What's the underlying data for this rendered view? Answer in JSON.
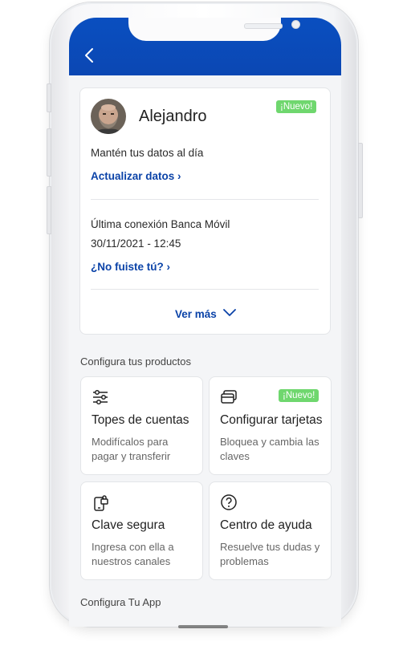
{
  "header": {
    "back_icon": "chevron-left-icon",
    "color": "#0b4bb8"
  },
  "profile": {
    "name": "Alejandro",
    "badge": "¡Nuevo!",
    "subtitle": "Mantén tus datos al día",
    "update_link": "Actualizar datos ›",
    "last_login_label": "Última conexión Banca Móvil",
    "last_login_value": "30/11/2021 - 12:45",
    "not_you_link": "¿No fuiste tú? ›",
    "more_label": "Ver más"
  },
  "products": {
    "section_title": "Configura tus productos",
    "tiles": [
      {
        "icon": "sliders-icon",
        "title": "Topes de cuentas",
        "desc": "Modifícalos para pagar y transferir"
      },
      {
        "icon": "cards-icon",
        "title": "Configurar tarjetas",
        "desc": "Bloquea y cambia las claves",
        "badge": "¡Nuevo!"
      },
      {
        "icon": "phone-lock-icon",
        "title": "Clave segura",
        "desc": "Ingresa con ella a nuestros canales"
      },
      {
        "icon": "help-circle-icon",
        "title": "Centro de ayuda",
        "desc": "Resuelve tus dudas y problemas"
      }
    ]
  },
  "app_section_title": "Configura Tu App",
  "colors": {
    "accent": "#0b43a8",
    "badge": "#6fd76e",
    "background": "#f4f5f7"
  }
}
